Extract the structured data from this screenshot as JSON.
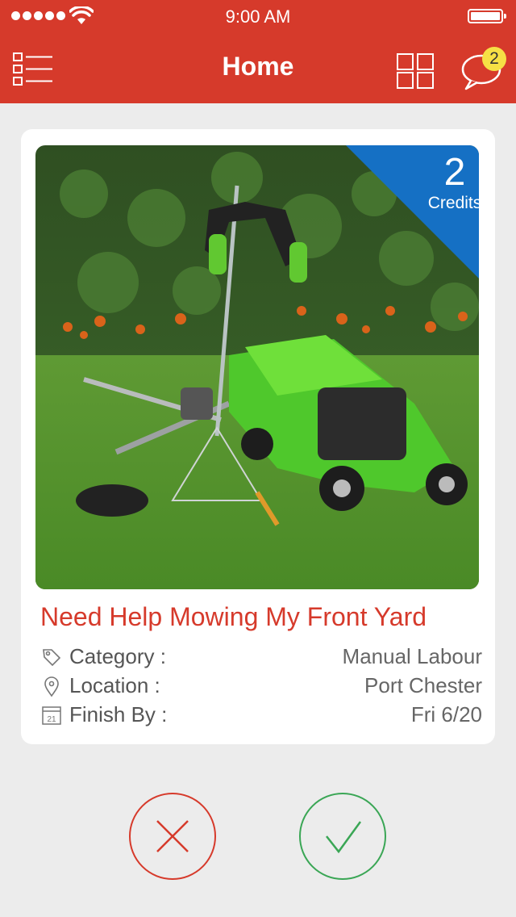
{
  "status_bar": {
    "time": "9:00 AM",
    "signal_dots": 5
  },
  "header": {
    "title": "Home",
    "notification_count": "2"
  },
  "icons": {
    "menu": "list-menu-icon",
    "grid": "grid-view-icon",
    "chat": "chat-bubble-icon",
    "category": "tag-icon",
    "location": "location-pin-icon",
    "finish": "calendar-icon",
    "reject": "close-icon",
    "accept": "checkmark-icon"
  },
  "colors": {
    "brand": "#d63a2b",
    "credits_ribbon": "#1570c4",
    "accept": "#3aa655",
    "badge": "#f6e045",
    "background": "#ececec"
  },
  "job": {
    "credits": "2",
    "credits_label": "Credits",
    "title": "Need Help Mowing My Front Yard",
    "calendar_day": "21",
    "details": [
      {
        "label": "Category :",
        "value": "Manual Labour"
      },
      {
        "label": "Location :",
        "value": "Port Chester"
      },
      {
        "label": "Finish By :",
        "value": "Fri 6/20"
      }
    ]
  }
}
